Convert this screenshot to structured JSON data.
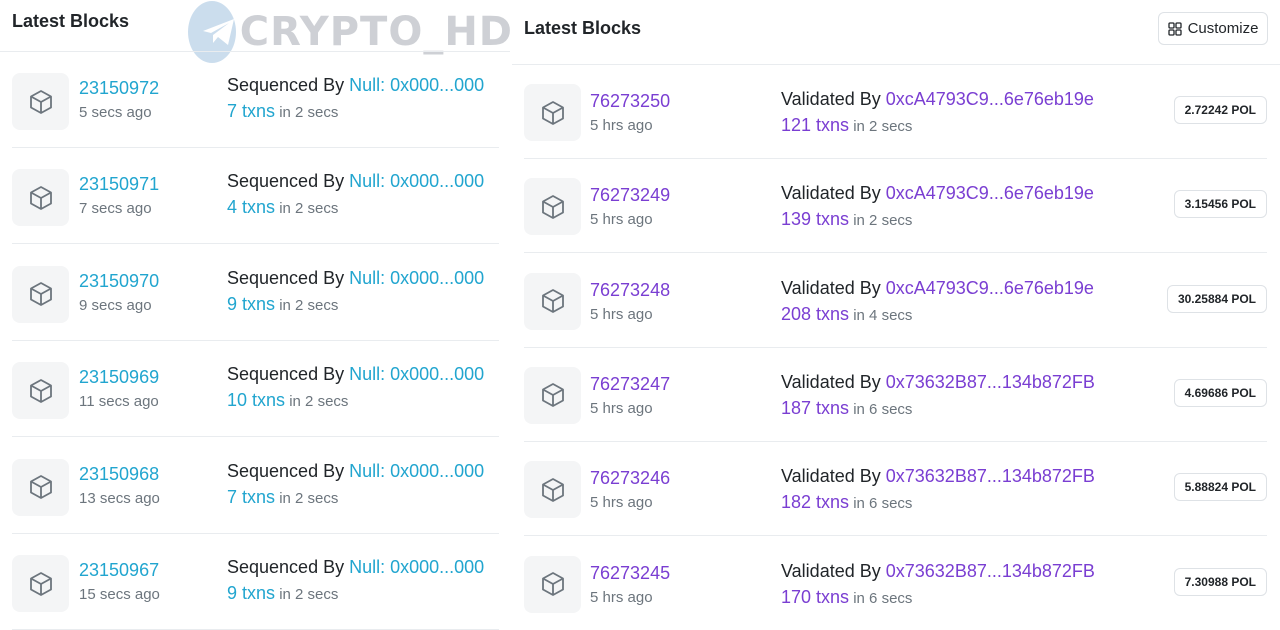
{
  "left": {
    "title": "Latest Blocks",
    "watermark": "CRYPTO_HD",
    "blocks": [
      {
        "number": "23150972",
        "age": "5 secs ago",
        "by_label": "Sequenced By",
        "by_addr": "Null: 0x000...000",
        "txns": "7 txns",
        "time": "in 2 secs"
      },
      {
        "number": "23150971",
        "age": "7 secs ago",
        "by_label": "Sequenced By",
        "by_addr": "Null: 0x000...000",
        "txns": "4 txns",
        "time": "in 2 secs"
      },
      {
        "number": "23150970",
        "age": "9 secs ago",
        "by_label": "Sequenced By",
        "by_addr": "Null: 0x000...000",
        "txns": "9 txns",
        "time": "in 2 secs"
      },
      {
        "number": "23150969",
        "age": "11 secs ago",
        "by_label": "Sequenced By",
        "by_addr": "Null: 0x000...000",
        "txns": "10 txns",
        "time": "in 2 secs"
      },
      {
        "number": "23150968",
        "age": "13 secs ago",
        "by_label": "Sequenced By",
        "by_addr": "Null: 0x000...000",
        "txns": "7 txns",
        "time": "in 2 secs"
      },
      {
        "number": "23150967",
        "age": "15 secs ago",
        "by_label": "Sequenced By",
        "by_addr": "Null: 0x000...000",
        "txns": "9 txns",
        "time": "in 2 secs"
      }
    ]
  },
  "right": {
    "title": "Latest Blocks",
    "customize_label": "Customize",
    "blocks": [
      {
        "number": "76273250",
        "age": "5 hrs ago",
        "by_label": "Validated By",
        "by_addr": "0xcA4793C9...6e76eb19e",
        "txns": "121 txns",
        "time": "in 2 secs",
        "reward": "2.72242 POL"
      },
      {
        "number": "76273249",
        "age": "5 hrs ago",
        "by_label": "Validated By",
        "by_addr": "0xcA4793C9...6e76eb19e",
        "txns": "139 txns",
        "time": "in 2 secs",
        "reward": "3.15456 POL"
      },
      {
        "number": "76273248",
        "age": "5 hrs ago",
        "by_label": "Validated By",
        "by_addr": "0xcA4793C9...6e76eb19e",
        "txns": "208 txns",
        "time": "in 4 secs",
        "reward": "30.25884 POL"
      },
      {
        "number": "76273247",
        "age": "5 hrs ago",
        "by_label": "Validated By",
        "by_addr": "0x73632B87...134b872FB",
        "txns": "187 txns",
        "time": "in 6 secs",
        "reward": "4.69686 POL"
      },
      {
        "number": "76273246",
        "age": "5 hrs ago",
        "by_label": "Validated By",
        "by_addr": "0x73632B87...134b872FB",
        "txns": "182 txns",
        "time": "in 6 secs",
        "reward": "5.88824 POL"
      },
      {
        "number": "76273245",
        "age": "5 hrs ago",
        "by_label": "Validated By",
        "by_addr": "0x73632B87...134b872FB",
        "txns": "170 txns",
        "time": "in 6 secs",
        "reward": "7.30988 POL"
      }
    ]
  },
  "icons": {
    "block": "cube-icon",
    "customize": "grid-icon",
    "watermark": "telegram-icon"
  },
  "colors": {
    "left_link": "#21a5cf",
    "right_link": "#7a3ed2"
  }
}
